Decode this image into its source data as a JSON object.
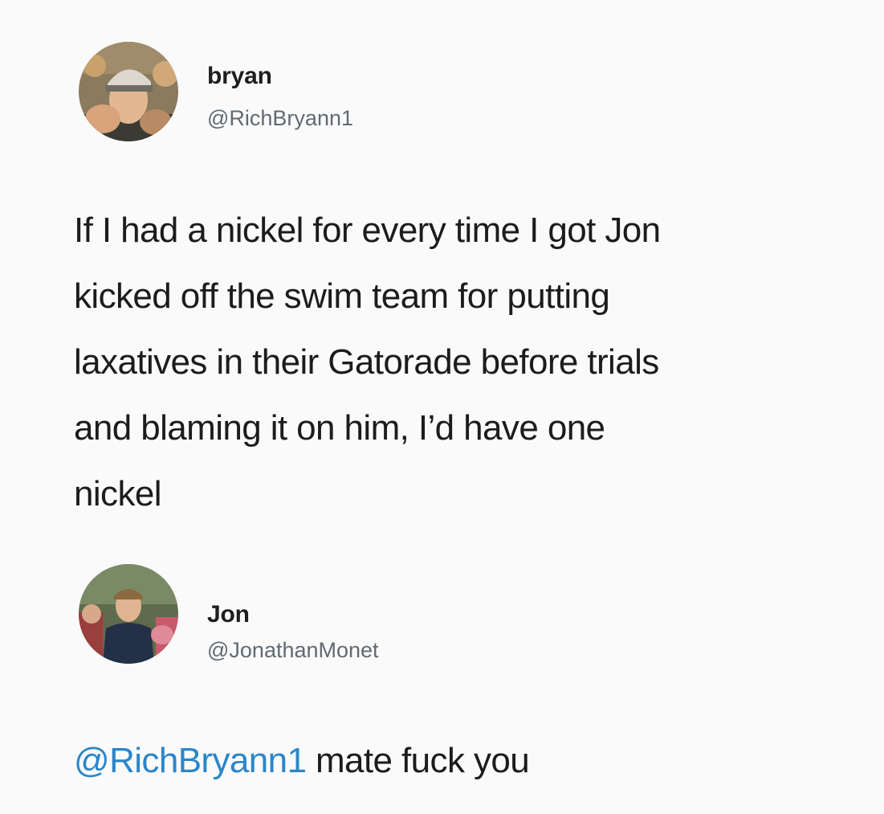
{
  "tweet": {
    "author_name": "bryan",
    "author_handle": "@RichBryann1",
    "text_lines": [
      "If I had a nickel for every time I got Jon",
      "kicked off the swim team for putting",
      "laxatives in their Gatorade before trials",
      "and blaming it on him, I’d have one",
      "nickel"
    ]
  },
  "reply": {
    "author_name": "Jon",
    "author_handle": "@JonathanMonet",
    "mention": "@RichBryann1",
    "text": " mate fuck you"
  },
  "colors": {
    "background": "#fafafa",
    "text": "#1c1c1c",
    "handle": "#616a72",
    "mention": "#2b86c9"
  }
}
